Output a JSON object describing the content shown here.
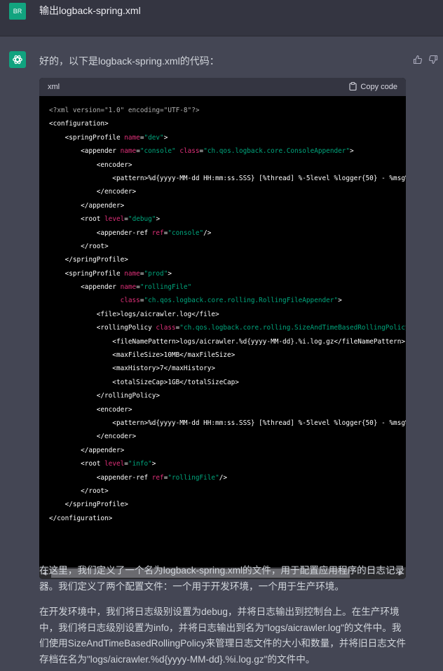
{
  "user": {
    "avatar_initials": "BR",
    "message": "输出logback-spring.xml"
  },
  "assistant": {
    "intro": "好的，以下是logback-spring.xml的代码：",
    "code": {
      "language": "xml",
      "copy_label": "Copy code",
      "lines": [
        [
          [
            "meta",
            "<?xml version=\"1.0\" encoding=\"UTF-8\"?>"
          ]
        ],
        [
          [
            "tag",
            "<configuration>"
          ]
        ],
        [
          [
            "tag",
            "    <springProfile "
          ],
          [
            "attr",
            "name"
          ],
          [
            "tag",
            "="
          ],
          [
            "str",
            "\"dev\""
          ],
          [
            "tag",
            ">"
          ]
        ],
        [
          [
            "tag",
            "        <appender "
          ],
          [
            "attr",
            "name"
          ],
          [
            "tag",
            "="
          ],
          [
            "str",
            "\"console\""
          ],
          [
            "tag",
            " "
          ],
          [
            "attr",
            "class"
          ],
          [
            "tag",
            "="
          ],
          [
            "str",
            "\"ch.qos.logback.core.ConsoleAppender\""
          ],
          [
            "tag",
            ">"
          ]
        ],
        [
          [
            "tag",
            "            <encoder>"
          ]
        ],
        [
          [
            "tag",
            "                <pattern>%d{yyyy-MM-dd HH:mm:ss.SSS} [%thread] %-5level %logger{50} - %msg%"
          ]
        ],
        [
          [
            "tag",
            "            </encoder>"
          ]
        ],
        [
          [
            "tag",
            "        </appender>"
          ]
        ],
        [
          [
            "tag",
            "        <root "
          ],
          [
            "attr",
            "level"
          ],
          [
            "tag",
            "="
          ],
          [
            "str",
            "\"debug\""
          ],
          [
            "tag",
            ">"
          ]
        ],
        [
          [
            "tag",
            "            <appender-ref "
          ],
          [
            "attr",
            "ref"
          ],
          [
            "tag",
            "="
          ],
          [
            "str",
            "\"console\""
          ],
          [
            "tag",
            "/>"
          ]
        ],
        [
          [
            "tag",
            "        </root>"
          ]
        ],
        [
          [
            "tag",
            "    </springProfile>"
          ]
        ],
        [
          [
            "tag",
            "    <springProfile "
          ],
          [
            "attr",
            "name"
          ],
          [
            "tag",
            "="
          ],
          [
            "str",
            "\"prod\""
          ],
          [
            "tag",
            ">"
          ]
        ],
        [
          [
            "tag",
            "        <appender "
          ],
          [
            "attr",
            "name"
          ],
          [
            "tag",
            "="
          ],
          [
            "str",
            "\"rollingFile\""
          ]
        ],
        [
          [
            "tag",
            "                  "
          ],
          [
            "attr",
            "class"
          ],
          [
            "tag",
            "="
          ],
          [
            "str",
            "\"ch.qos.logback.core.rolling.RollingFileAppender\""
          ],
          [
            "tag",
            ">"
          ]
        ],
        [
          [
            "tag",
            "            <file>logs/aicrawler.log</file>"
          ]
        ],
        [
          [
            "tag",
            "            <rollingPolicy "
          ],
          [
            "attr",
            "class"
          ],
          [
            "tag",
            "="
          ],
          [
            "str",
            "\"ch.qos.logback.core.rolling.SizeAndTimeBasedRollingPolicy"
          ]
        ],
        [
          [
            "tag",
            "                <fileNamePattern>logs/aicrawler.%d{yyyy-MM-dd}.%i.log.gz</fileNamePattern>"
          ]
        ],
        [
          [
            "tag",
            "                <maxFileSize>10MB</maxFileSize>"
          ]
        ],
        [
          [
            "tag",
            "                <maxHistory>7</maxHistory>"
          ]
        ],
        [
          [
            "tag",
            "                <totalSizeCap>1GB</totalSizeCap>"
          ]
        ],
        [
          [
            "tag",
            "            </rollingPolicy>"
          ]
        ],
        [
          [
            "tag",
            "            <encoder>"
          ]
        ],
        [
          [
            "tag",
            "                <pattern>%d{yyyy-MM-dd HH:mm:ss.SSS} [%thread] %-5level %logger{50} - %msg%"
          ]
        ],
        [
          [
            "tag",
            "            </encoder>"
          ]
        ],
        [
          [
            "tag",
            "        </appender>"
          ]
        ],
        [
          [
            "tag",
            "        <root "
          ],
          [
            "attr",
            "level"
          ],
          [
            "tag",
            "="
          ],
          [
            "str",
            "\"info\""
          ],
          [
            "tag",
            ">"
          ]
        ],
        [
          [
            "tag",
            "            <appender-ref "
          ],
          [
            "attr",
            "ref"
          ],
          [
            "tag",
            "="
          ],
          [
            "str",
            "\"rollingFile\""
          ],
          [
            "tag",
            "/>"
          ]
        ],
        [
          [
            "tag",
            "        </root>"
          ]
        ],
        [
          [
            "tag",
            "    </springProfile>"
          ]
        ],
        [
          [
            "tag",
            "</configuration>"
          ]
        ]
      ]
    },
    "paragraphs": [
      "在这里，我们定义了一个名为logback-spring.xml的文件，用于配置应用程序的日志记录器。我们定义了两个配置文件：一个用于开发环境，一个用于生产环境。",
      "在开发环境中，我们将日志级别设置为debug，并将日志输出到控制台上。在生产环境中，我们将日志级别设置为info，并将日志输出到名为\"logs/aicrawler.log\"的文件中。我们使用SizeAndTimeBasedRollingPolicy来管理日志文件的大小和数量，并将旧日志文件存档在名为\"logs/aicrawler.%d{yyyy-MM-dd}.%i.log.gz\"的文件中。"
    ]
  },
  "colors": {
    "user_bg": "#343541",
    "assistant_bg": "#444654",
    "code_bg": "#000000",
    "code_attr": "#df3079",
    "code_string": "#00a67d",
    "brand": "#10a37f"
  },
  "icons": [
    "openai-logo-icon",
    "thumbs-up-icon",
    "thumbs-down-icon",
    "clipboard-icon",
    "scroll-left-arrow-icon",
    "scroll-right-arrow-icon"
  ]
}
